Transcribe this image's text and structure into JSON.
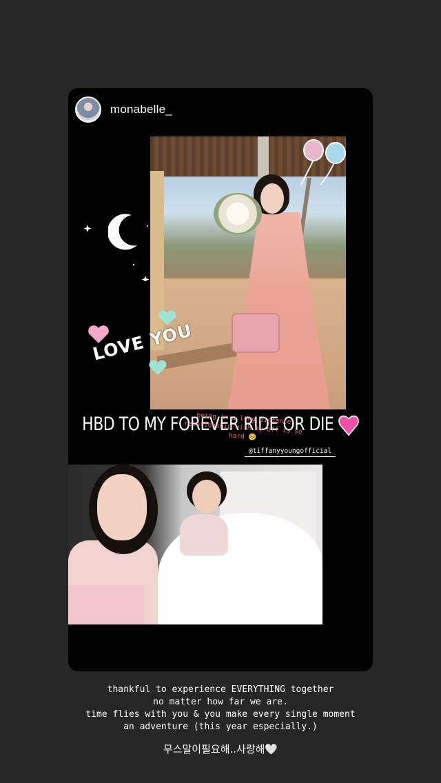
{
  "story": {
    "username": "monabelle_",
    "sticker_text": "LOVE YOU",
    "headline": "HBD TO MY FOREVER RIDE OR DIE",
    "mention": "@tiffanyyoungofficial",
    "photo_note": "being in a long distance relationship with my bff is so hard 🥺"
  },
  "caption": {
    "lines": [
      "thankful to experience EVERYTHING together",
      "no matter how far we are.",
      "time flies with you & you make every single moment",
      "an adventure (this year especially.)"
    ],
    "korean": "무스말이필요해..사랑해🤍"
  },
  "colors": {
    "background": "#262626",
    "card": "#000000",
    "heart_pink": "#f6a8c8",
    "heart_mint": "#9fe3d6",
    "note_pink": "#f35e7d"
  },
  "icons": [
    "avatar",
    "moon-icon",
    "star-icon",
    "heart-icon",
    "balloon-icon",
    "pink-heart-emoji"
  ]
}
